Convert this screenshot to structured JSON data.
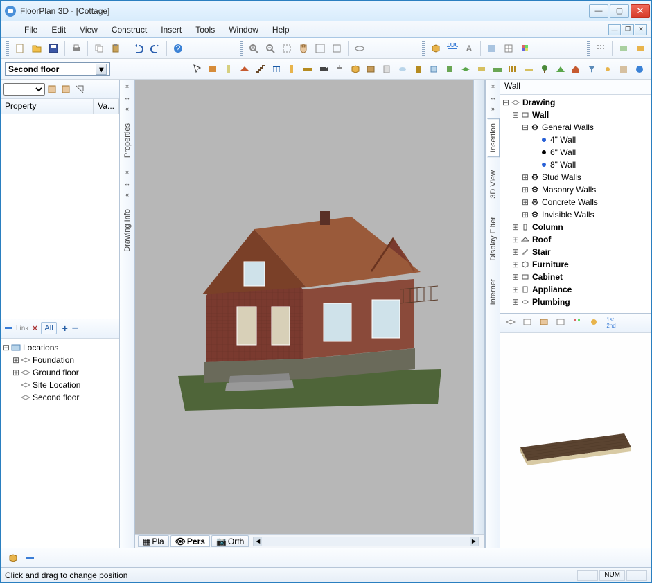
{
  "app": {
    "title": "FloorPlan 3D - [Cottage]"
  },
  "menus": [
    "File",
    "Edit",
    "View",
    "Construct",
    "Insert",
    "Tools",
    "Window",
    "Help"
  ],
  "level_selector": "Second floor",
  "property_panel": {
    "col_property": "Property",
    "col_value": "Va..."
  },
  "location_panel": {
    "filter_all": "All",
    "root": "Locations",
    "items": [
      "Foundation",
      "Ground floor",
      "Site Location",
      "Second floor"
    ]
  },
  "side_tabs_left": [
    "Properties",
    "Drawing Info"
  ],
  "side_tabs_right": [
    "Insertion",
    "3D View",
    "Display Filter",
    "Internet"
  ],
  "viewport_tabs": [
    "Pla",
    "Pers",
    "Orth"
  ],
  "right_panel": {
    "header": "Wall",
    "tree": {
      "root": "Drawing",
      "wall": "Wall",
      "general_walls": "General Walls",
      "wall_types": [
        "4\" Wall",
        "6\" Wall",
        "8\" Wall"
      ],
      "wall_cats": [
        "Stud Walls",
        "Masonry Walls",
        "Concrete Walls",
        "Invisible Walls"
      ],
      "others": [
        "Column",
        "Roof",
        "Stair",
        "Furniture",
        "Cabinet",
        "Appliance",
        "Plumbing"
      ]
    }
  },
  "status": {
    "text": "Click and drag to change position",
    "num": "NUM"
  }
}
